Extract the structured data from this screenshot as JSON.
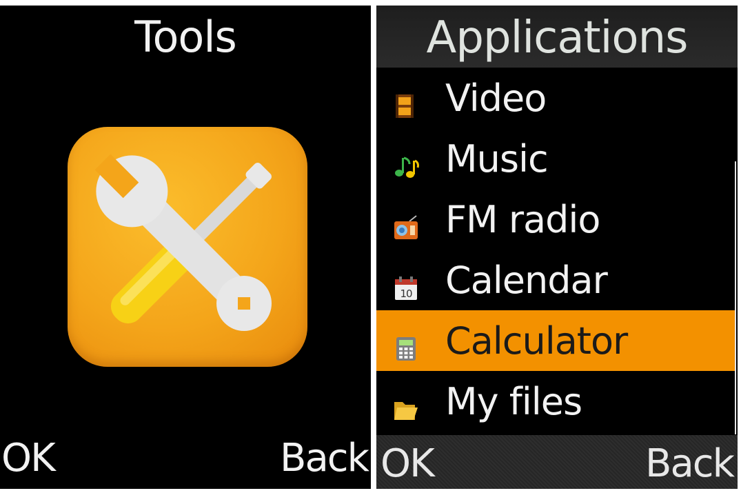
{
  "left_screen": {
    "title": "Tools",
    "icon": "tools-icon",
    "softkeys": {
      "left": "OK",
      "right": "Back"
    }
  },
  "right_screen": {
    "title": "Applications",
    "items": [
      {
        "label": "Video",
        "icon": "video-icon",
        "selected": false
      },
      {
        "label": "Music",
        "icon": "music-icon",
        "selected": false
      },
      {
        "label": "FM radio",
        "icon": "radio-icon",
        "selected": false
      },
      {
        "label": "Calendar",
        "icon": "calendar-icon",
        "selected": false
      },
      {
        "label": "Calculator",
        "icon": "calculator-icon",
        "selected": true
      },
      {
        "label": "My files",
        "icon": "folder-icon",
        "selected": false
      }
    ],
    "calendar_icon_day": "10",
    "softkeys": {
      "left": "OK",
      "right": "Back"
    }
  },
  "colors": {
    "highlight": "#f39100",
    "icon_orange": "#f4a51a",
    "background": "#000000",
    "text": "#f2f2f2"
  }
}
